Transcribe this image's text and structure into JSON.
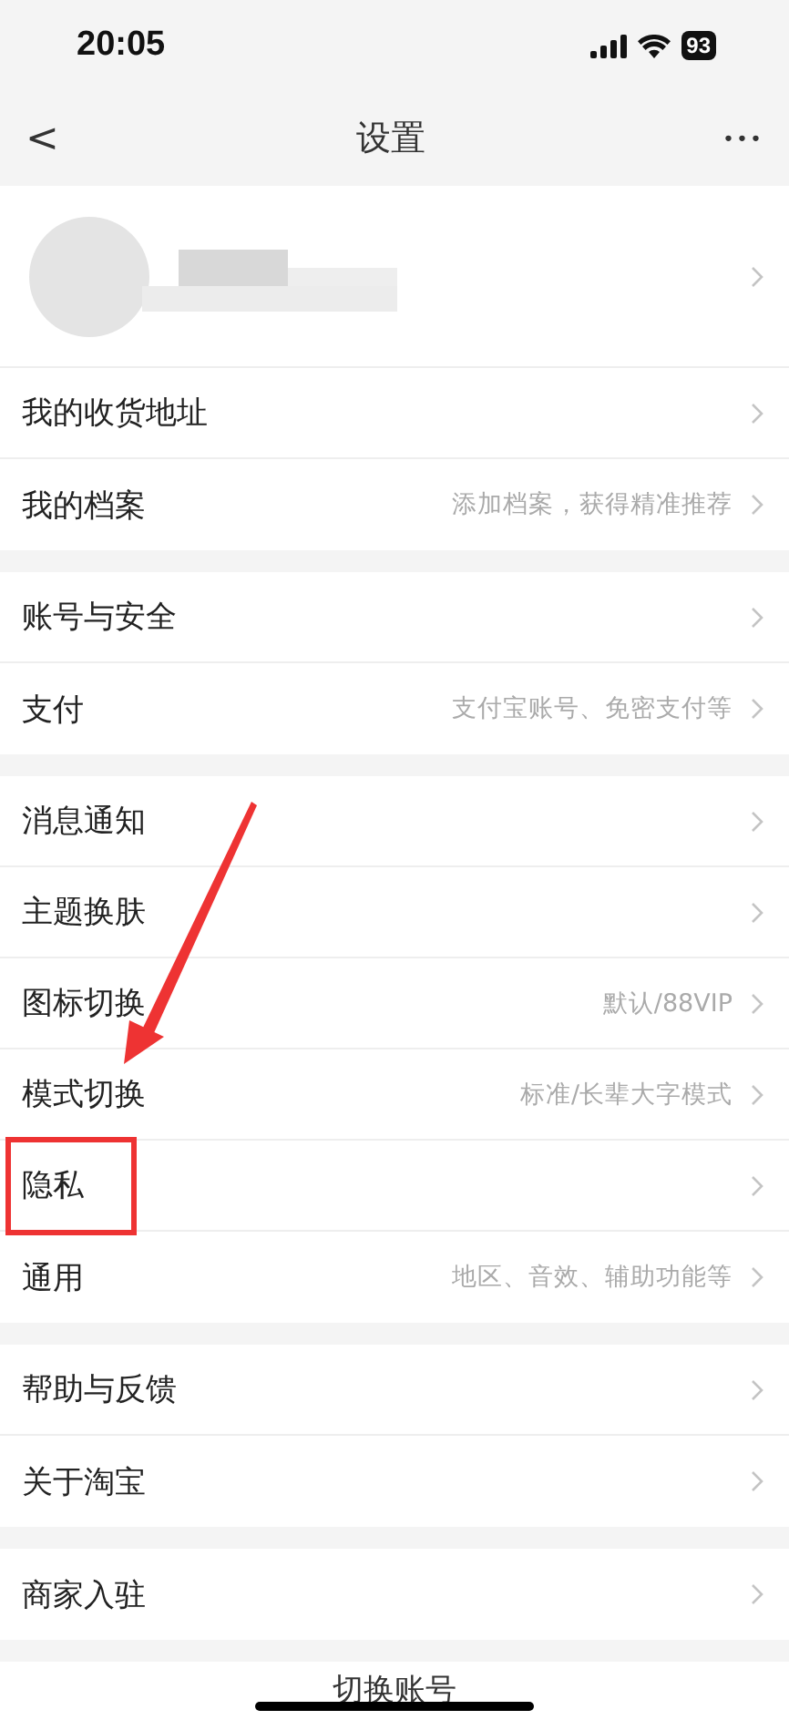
{
  "status_bar": {
    "time": "20:05",
    "battery": "93"
  },
  "nav": {
    "back": "<",
    "title": "设置",
    "more": "•••"
  },
  "groups": [
    {
      "items": [
        {
          "kind": "profile"
        },
        {
          "kind": "row",
          "label": "我的收货地址"
        },
        {
          "kind": "row",
          "label": "我的档案",
          "detail": "添加档案，获得精准推荐"
        }
      ]
    },
    {
      "items": [
        {
          "kind": "row",
          "label": "账号与安全"
        },
        {
          "kind": "row",
          "label": "支付",
          "detail": "支付宝账号、免密支付等"
        }
      ]
    },
    {
      "items": [
        {
          "kind": "row",
          "label": "消息通知"
        },
        {
          "kind": "row",
          "label": "主题换肤"
        },
        {
          "kind": "row",
          "label": "图标切换",
          "detail": "默认/88VIP"
        },
        {
          "kind": "row",
          "label": "模式切换",
          "detail": "标准/长辈大字模式"
        },
        {
          "kind": "row",
          "label": "隐私",
          "highlighted": true
        },
        {
          "kind": "row",
          "label": "通用",
          "detail": "地区、音效、辅助功能等"
        }
      ]
    },
    {
      "items": [
        {
          "kind": "row",
          "label": "帮助与反馈"
        },
        {
          "kind": "row",
          "label": "关于淘宝"
        }
      ]
    },
    {
      "items": [
        {
          "kind": "row",
          "label": "商家入驻"
        }
      ]
    }
  ],
  "switch_account": "切换账号"
}
